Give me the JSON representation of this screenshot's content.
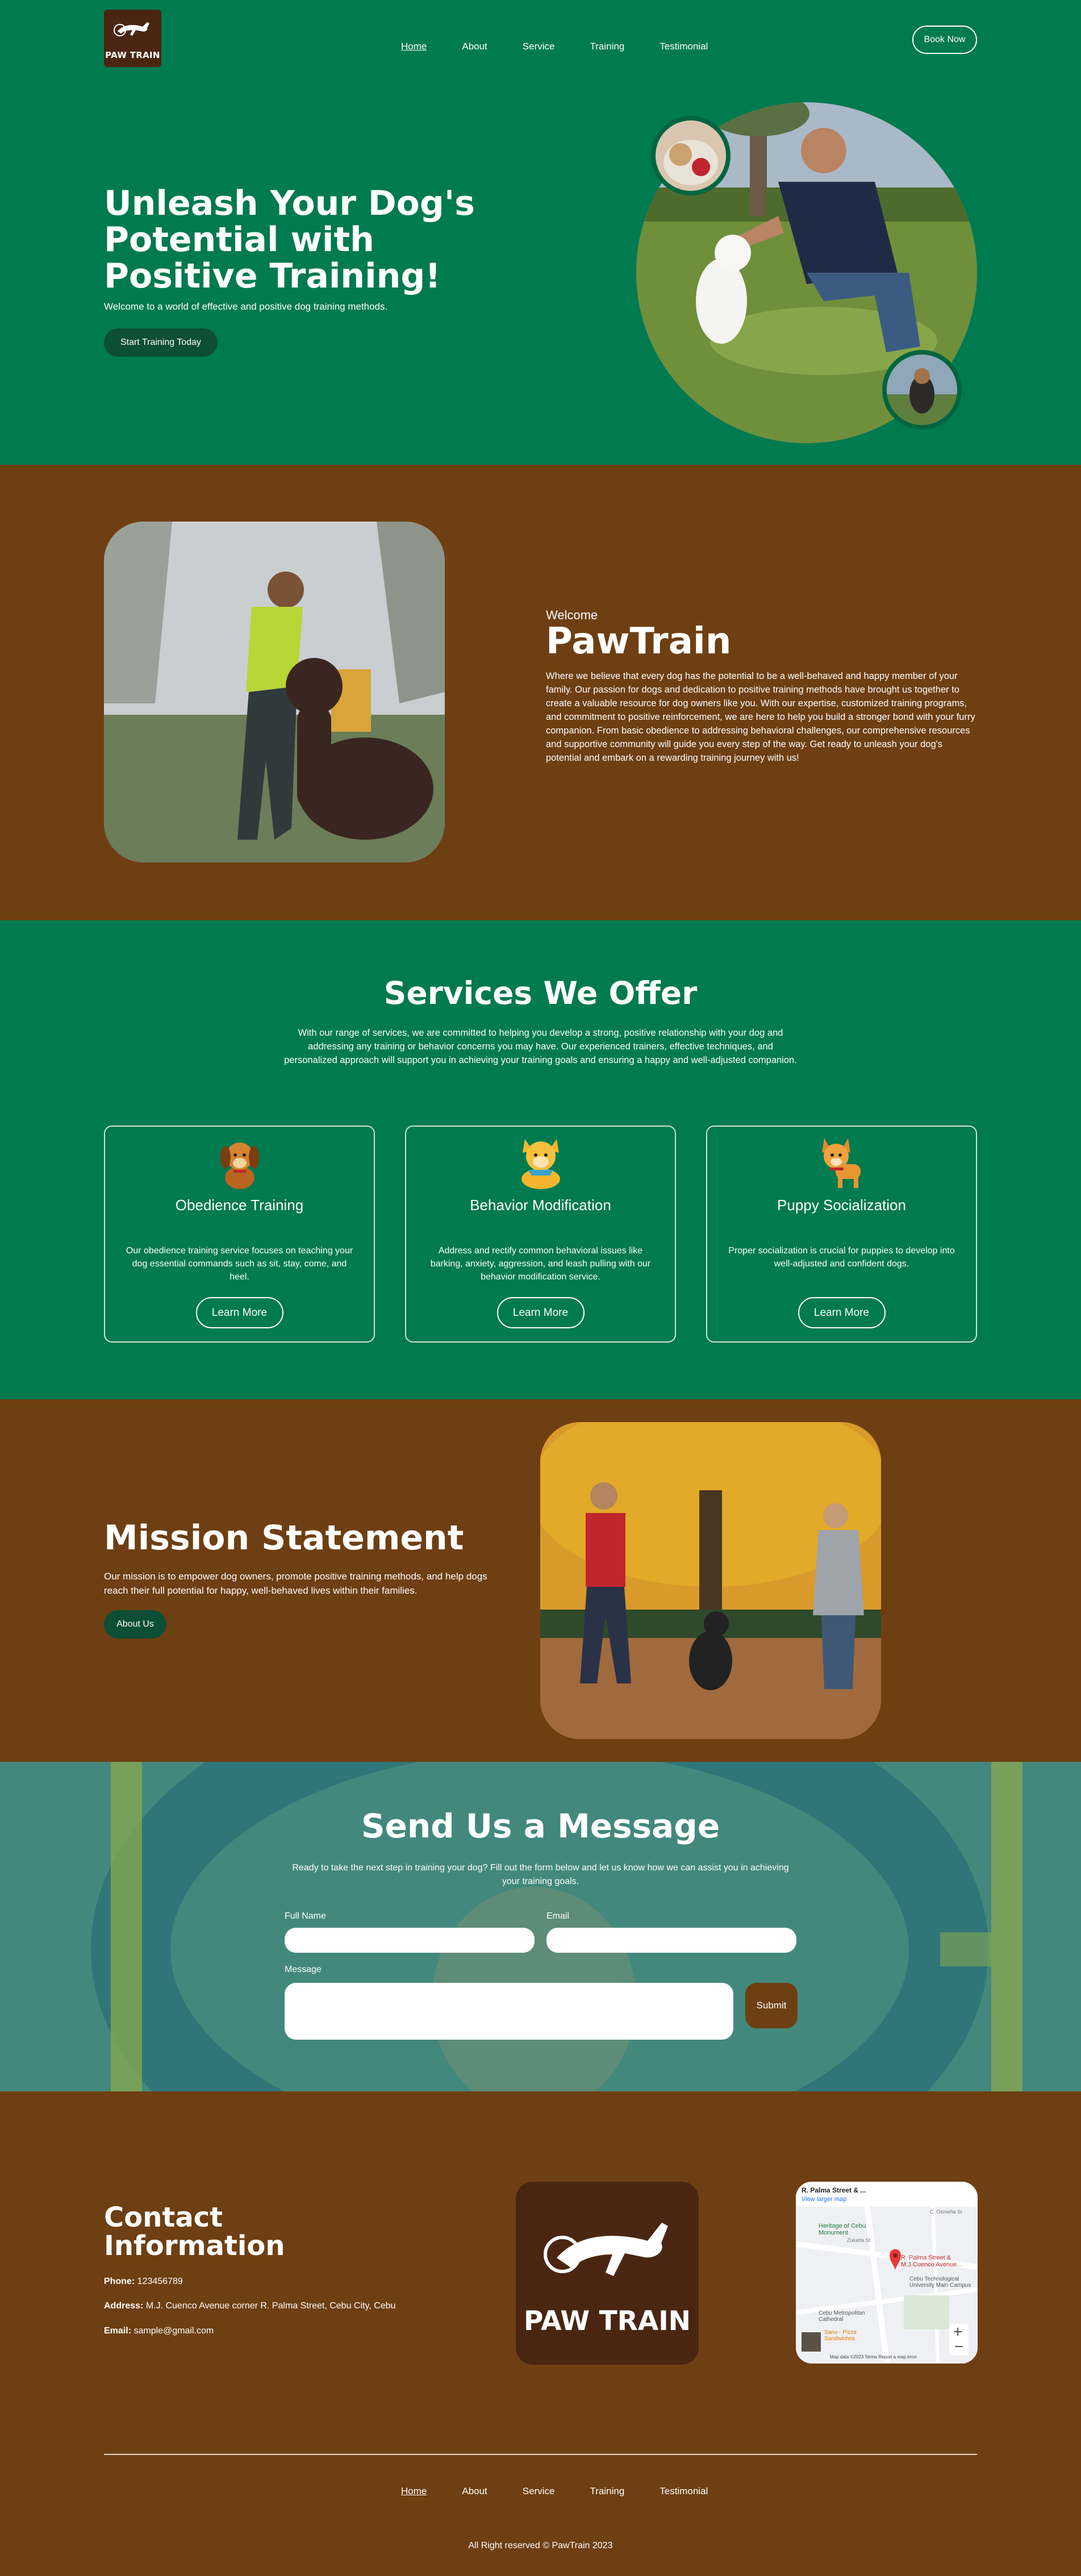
{
  "brand": {
    "logo_text": "PAW TRAIN"
  },
  "nav": {
    "items": [
      "Home",
      "About",
      "Service",
      "Training",
      "Testimonial"
    ]
  },
  "header": {
    "book_label": "Book Now"
  },
  "hero": {
    "title": "Unleash Your Dog's Potential with Positive Training!",
    "subtitle": "Welcome to a world of effective and positive dog training methods.",
    "cta_label": "Start Training Today"
  },
  "about": {
    "kicker": "Welcome",
    "title": "PawTrain",
    "text": "Where we believe that every dog has the potential to be a well-behaved and happy member of your family. Our passion for dogs and dedication to positive training methods have brought us together to create a valuable resource for dog owners like you. With our expertise, customized training programs, and commitment to positive reinforcement, we are here to help you build a stronger bond with your furry companion. From basic obedience to addressing behavioral challenges, our comprehensive resources and supportive community will guide you every step of the way. Get ready to unleash your dog's potential and embark on a rewarding training journey with us!"
  },
  "services": {
    "title": "Services We Offer",
    "intro": "With our range of services, we are committed to helping you develop a strong, positive relationship with your dog and addressing any training or behavior concerns you may have. Our experienced trainers, effective techniques, and personalized approach will support you in achieving your training goals and ensuring a happy and well-adjusted companion.",
    "cards": [
      {
        "title": "Obedience Training",
        "text": "Our obedience training service focuses on teaching your dog essential commands such as sit, stay, come, and heel.",
        "button": "Learn More",
        "icon": "dog-sitting-icon"
      },
      {
        "title": "Behavior Modification",
        "text": "Address and rectify common behavioral issues like barking, anxiety, aggression, and leash pulling with our behavior modification service.",
        "button": "Learn More",
        "icon": "dog-with-scarf-icon"
      },
      {
        "title": "Puppy Socialization",
        "text": "Proper socialization is crucial for puppies to develop into well-adjusted and confident dogs.",
        "button": "Learn More",
        "icon": "puppy-icon"
      }
    ]
  },
  "mission": {
    "title": "Mission Statement",
    "text": "Our mission is to empower dog owners, promote positive training methods, and help dogs reach their full potential for happy, well-behaved lives within their families.",
    "button": "About Us"
  },
  "message": {
    "title": "Send Us a Message",
    "intro": "Ready to take the next step in training your dog? Fill out the form below and let us know how we can assist you in achieving your training goals.",
    "full_name_label": "Full Name",
    "email_label": "Email",
    "message_label": "Message",
    "submit_label": "Submit"
  },
  "contact": {
    "title": "Contact Information",
    "phone_label": "Phone:",
    "phone": "123456789",
    "address_label": "Address:",
    "address": "M.J. Cuenco Avenue corner R. Palma Street, Cebu City, Cebu",
    "email_label": "Email:",
    "email": "sample@gmail.com"
  },
  "map": {
    "place_title": "R. Palma Street & ...",
    "view_larger": "View larger map",
    "labels": [
      "Heritage of Cebu Monument",
      "R. Palma Street & M.J.Cuenco Avenue...",
      "Cebu Technological University Main Campus",
      "Cebu Metropolitan Cathedral",
      "Sano - Pizza Sandwiches",
      "Zulueta St",
      "C. Osmeña St"
    ],
    "footer_text": "Map data ©2023  Terms  Report a map error"
  },
  "footer": {
    "copyright": "All Right reserved © PawTrain 2023"
  },
  "colors": {
    "green": "#007a4f",
    "brown": "#6e3f12",
    "dark_green": "#0d4e36",
    "logo_brown": "#4a2612"
  }
}
